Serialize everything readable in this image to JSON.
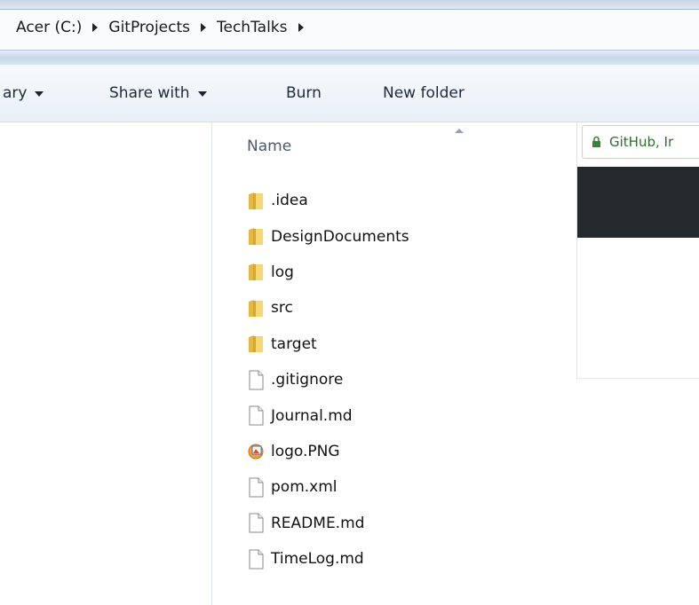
{
  "address_bar": {
    "breadcrumb": [
      "Acer (C:)",
      "GitProjects",
      "TechTalks"
    ]
  },
  "toolbar": {
    "library_label": "ary",
    "share_label": "Share with",
    "burn_label": "Burn",
    "new_folder_label": "New folder"
  },
  "file_pane": {
    "column_name": "Name",
    "files": [
      {
        "name": ".idea",
        "icon": "folder-icon"
      },
      {
        "name": "DesignDocuments",
        "icon": "folder-icon"
      },
      {
        "name": "log",
        "icon": "folder-icon"
      },
      {
        "name": "src",
        "icon": "folder-icon"
      },
      {
        "name": "target",
        "icon": "folder-icon"
      },
      {
        "name": ".gitignore",
        "icon": "file-icon"
      },
      {
        "name": "Journal.md",
        "icon": "file-icon"
      },
      {
        "name": "logo.PNG",
        "icon": "image-file-icon"
      },
      {
        "name": "pom.xml",
        "icon": "file-icon"
      },
      {
        "name": "README.md",
        "icon": "file-icon"
      },
      {
        "name": "TimeLog.md",
        "icon": "file-icon"
      }
    ]
  },
  "browser": {
    "site_label": "GitHub, Ir",
    "icon": "lock-icon",
    "secure_color": "#2c6e2c",
    "header_color": "#24292e"
  }
}
